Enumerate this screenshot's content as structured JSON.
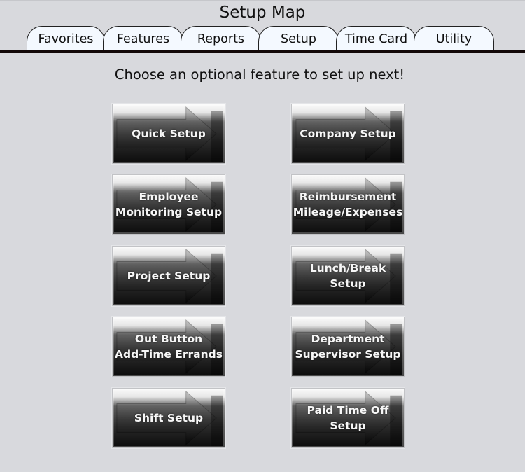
{
  "header": {
    "title": "Setup Map"
  },
  "tabs": [
    {
      "label": "Favorites"
    },
    {
      "label": "Features"
    },
    {
      "label": "Reports"
    },
    {
      "label": "Setup"
    },
    {
      "label": "Time Card"
    },
    {
      "label": "Utility"
    }
  ],
  "main": {
    "prompt": "Choose an optional feature to set up next!",
    "buttons": [
      {
        "lines": [
          "Quick Setup"
        ],
        "icon": "arrow-right-icon"
      },
      {
        "lines": [
          "Company Setup"
        ],
        "icon": "arrow-right-icon"
      },
      {
        "lines": [
          "Employee",
          "Monitoring Setup"
        ],
        "icon": "arrow-right-icon"
      },
      {
        "lines": [
          "Reimbursement",
          "Mileage/Expenses"
        ],
        "icon": "arrow-right-icon"
      },
      {
        "lines": [
          "Project Setup"
        ],
        "icon": "arrow-right-icon"
      },
      {
        "lines": [
          "Lunch/Break",
          "Setup"
        ],
        "icon": "arrow-right-icon"
      },
      {
        "lines": [
          "Out Button",
          "Add-Time Errands"
        ],
        "icon": "arrow-right-icon"
      },
      {
        "lines": [
          "Department",
          "Supervisor Setup"
        ],
        "icon": "arrow-right-icon"
      },
      {
        "lines": [
          "Shift Setup"
        ],
        "icon": "arrow-right-icon"
      },
      {
        "lines": [
          "Paid Time Off",
          "Setup"
        ],
        "icon": "arrow-right-icon"
      }
    ]
  }
}
